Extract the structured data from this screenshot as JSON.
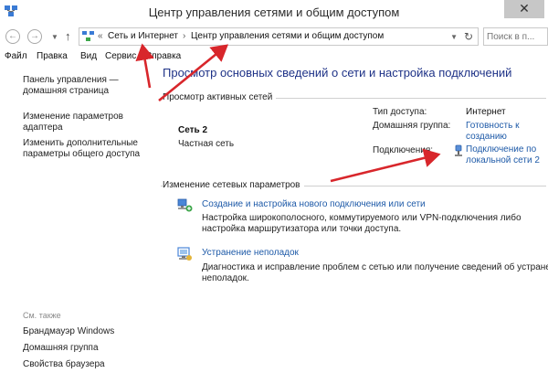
{
  "window": {
    "title": "Центр управления сетями и общим доступом",
    "close_glyph": "✕"
  },
  "address": {
    "back_glyph": "←",
    "forward_glyph": "→",
    "up_glyph": "↑",
    "crumb_prefix": "«",
    "crumb_separator": "›",
    "crumbs": [
      "Сеть и Интернет",
      "Центр управления сетями и общим доступом"
    ],
    "refresh_glyph": "↻",
    "search_placeholder": "Поиск в п..."
  },
  "menu": {
    "items": [
      "Файл",
      "Правка",
      "Вид",
      "Сервис",
      "Справка"
    ]
  },
  "sidebar": {
    "home_line1": "Панель управления —",
    "home_line2": "домашняя страница",
    "adapter_line1": "Изменение параметров",
    "adapter_line2": "адаптера",
    "sharing_line1": "Изменить дополнительные",
    "sharing_line2": "параметры общего доступа",
    "see_also": "См. также",
    "see_also_items": [
      "Брандмауэр Windows",
      "Домашняя группа",
      "Свойства браузера"
    ]
  },
  "main": {
    "title": "Просмотр основных сведений о сети и настройка подключений",
    "active_networks_label": "Просмотр активных сетей",
    "network": {
      "name": "Сеть 2",
      "type": "Частная сеть",
      "access_type_label": "Тип доступа:",
      "access_type_value": "Интернет",
      "homegroup_label": "Домашняя группа:",
      "homegroup_link_line1": "Готовность к",
      "homegroup_link_line2": "созданию",
      "connections_label": "Подключения:",
      "connection_link_line1": "Подключение по",
      "connection_link_line2": "локальной сети 2"
    },
    "change_settings_label": "Изменение сетевых параметров",
    "tasks": [
      {
        "link": "Создание и настройка нового подключения или сети",
        "desc_line1": "Настройка широкополосного, коммутируемого или VPN-подключения либо",
        "desc_line2": "настройка маршрутизатора или точки доступа."
      },
      {
        "link": "Устранение неполадок",
        "desc_line1": "Диагностика и исправление проблем с сетью или получение сведений об устранении",
        "desc_line2": "неполадок."
      }
    ]
  },
  "colors": {
    "annotation_arrow": "#d8262b",
    "link": "#1e5aa8",
    "title": "#1e3287"
  },
  "icons": [
    "control-panel-icon",
    "network-connection-icon",
    "new-connection-icon",
    "troubleshoot-icon"
  ]
}
